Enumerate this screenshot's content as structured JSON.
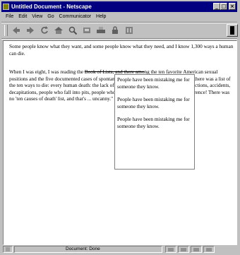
{
  "window": {
    "title": "Untitled Document - Netscape"
  },
  "menu": [
    "File",
    "Edit",
    "View",
    "Go",
    "Communicator",
    "Help"
  ],
  "toolbar": [
    "back-icon",
    "forward-icon",
    "reload-icon",
    "home-icon",
    "search-icon",
    "guide-icon",
    "print-icon",
    "security-icon",
    "stop-icon"
  ],
  "document": {
    "paragraph1": "Some people know what they want, and some people know what they need, and I know 1,300 ways a human can die.",
    "paragraph2": {
      "before": "When I was eight, I was reading the ",
      "struck": "Book of Lists, and there amo",
      "after": "ng the ten favorite American sexual positions and the five documented cases of spontaneous human combustion, I discovered there was a list of the ten ways to die: every human death: the lack of oxygen to the brain, heart disease, infections, accidents, decapitations, people who fall into pits, people who are eaten by sharks--it makes no difference! There was no 'ten causes of death' list, and that's ... uncanny.\""
    },
    "tooltip_items": [
      "People have been mistaking me for someone they know.",
      "People have been mistaking me for someone they know.",
      "People have been mistaking me for someone they know."
    ]
  },
  "status": {
    "text": "Document: Done"
  }
}
